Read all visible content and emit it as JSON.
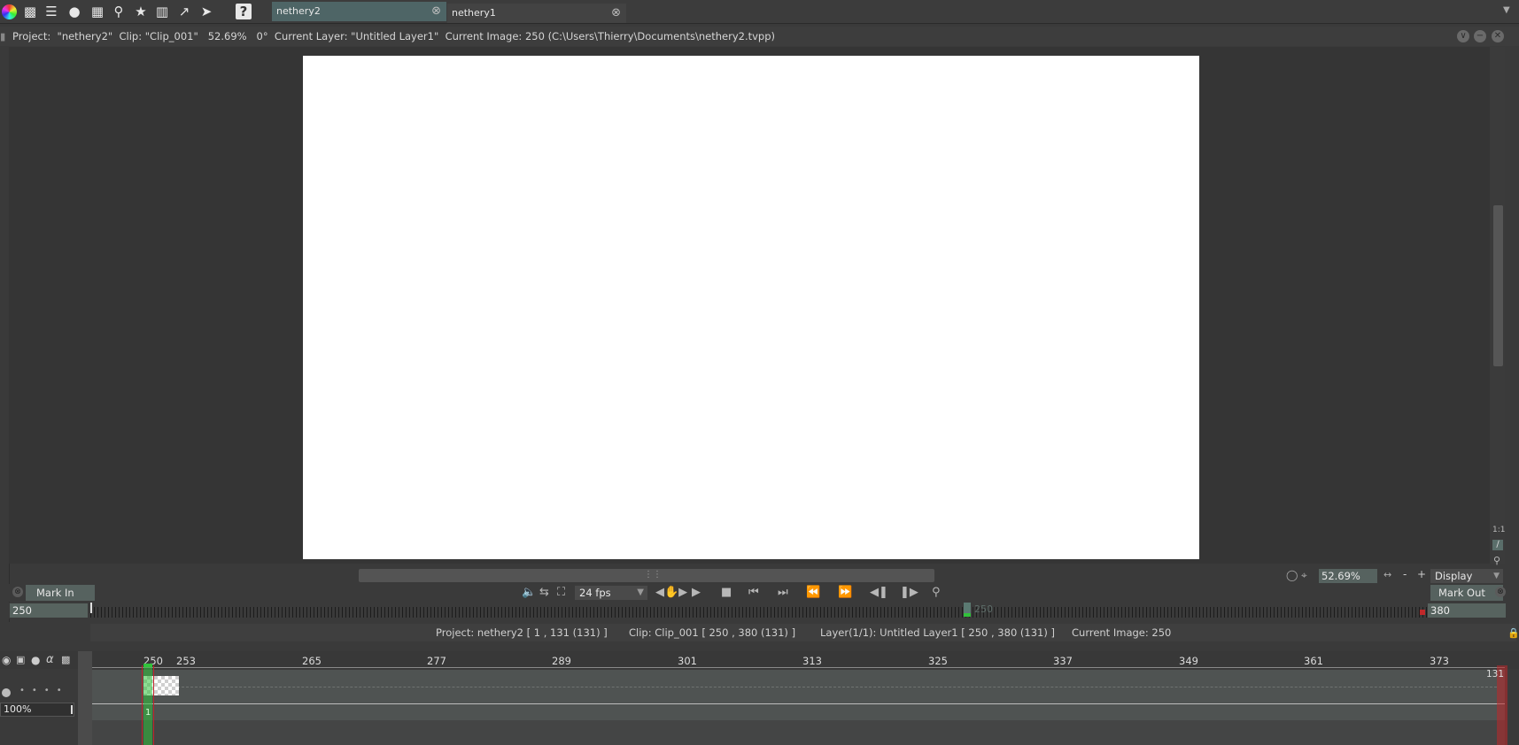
{
  "topbar": {
    "icons": [
      "color-wheel-icon",
      "stamp-icon",
      "layers-icon",
      "bulb-icon",
      "brush-rack-icon",
      "search-icon",
      "puppet-icon",
      "library-icon",
      "chart-icon",
      "paper-plane-icon",
      "help-icon"
    ],
    "tabs": [
      {
        "label": "nethery2",
        "active": true
      },
      {
        "label": "nethery1",
        "active": false
      }
    ]
  },
  "infobar": {
    "text": "Project:  \"nethery2\"  Clip: \"Clip_001\"   52.69%   0°  Current Layer: \"Untitled Layer1\"  Current Image: 250 (C:\\Users\\Thierry\\Documents\\nethery2.tvpp)"
  },
  "viewport": {
    "zoom_value": "52.69%",
    "zoom_minus": "-",
    "zoom_plus": "+",
    "display_label": "Display",
    "ratio_label": "1:1"
  },
  "transport": {
    "mark_in_label": "Mark In",
    "mark_out_label": "Mark Out",
    "fps_value": "24 fps"
  },
  "ruler": {
    "start_value": "250",
    "end_value": "380",
    "current_marker": "250"
  },
  "status": {
    "project": "Project: nethery2 [ 1 , 131  (131) ]",
    "clip": "Clip: Clip_001 [ 250 , 380  (131) ]",
    "layer": "Layer(1/1): Untitled Layer1 [ 250 , 380  (131) ]",
    "current_image": "Current Image: 250"
  },
  "timeline": {
    "frame_labels": [
      "250",
      "253",
      "265",
      "277",
      "289",
      "301",
      "313",
      "325",
      "337",
      "349",
      "361",
      "373"
    ],
    "opacity_value": "100%",
    "end_frame": "131",
    "first_frame_index": "1",
    "alpha_label": "α"
  },
  "colors": {
    "accent": "#56625f",
    "marker_green": "#31c23a",
    "marker_red": "#c0282a"
  }
}
